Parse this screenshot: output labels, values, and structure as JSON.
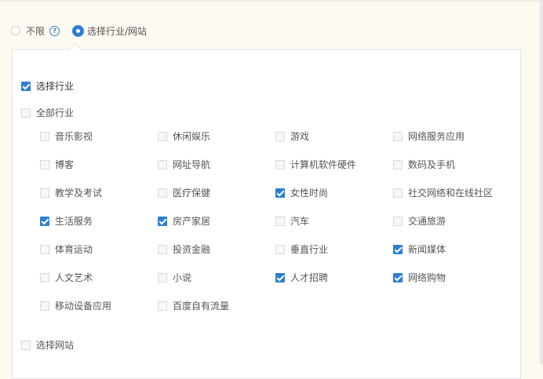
{
  "radio": {
    "unlimited": "不限",
    "industry_site": "选择行业/网站",
    "selected": "industry_site"
  },
  "select_industry": {
    "label": "选择行业",
    "checked": true
  },
  "all_industries": {
    "label": "全部行业",
    "checked": false
  },
  "industries": [
    {
      "label": "音乐影视",
      "checked": false
    },
    {
      "label": "休闲娱乐",
      "checked": false
    },
    {
      "label": "游戏",
      "checked": false
    },
    {
      "label": "网络服务应用",
      "checked": false
    },
    {
      "label": "博客",
      "checked": false
    },
    {
      "label": "网址导航",
      "checked": false
    },
    {
      "label": "计算机软件硬件",
      "checked": false
    },
    {
      "label": "数码及手机",
      "checked": false
    },
    {
      "label": "教学及考试",
      "checked": false
    },
    {
      "label": "医疗保健",
      "checked": false
    },
    {
      "label": "女性时尚",
      "checked": true
    },
    {
      "label": "社交网络和在线社区",
      "checked": false
    },
    {
      "label": "生活服务",
      "checked": true
    },
    {
      "label": "房产家居",
      "checked": true
    },
    {
      "label": "汽车",
      "checked": false
    },
    {
      "label": "交通旅游",
      "checked": false
    },
    {
      "label": "体育运动",
      "checked": false
    },
    {
      "label": "投资金融",
      "checked": false
    },
    {
      "label": "垂直行业",
      "checked": false
    },
    {
      "label": "新闻媒体",
      "checked": true
    },
    {
      "label": "人文艺术",
      "checked": false
    },
    {
      "label": "小说",
      "checked": false
    },
    {
      "label": "人才招聘",
      "checked": true
    },
    {
      "label": "网络购物",
      "checked": true
    },
    {
      "label": "移动设备应用",
      "checked": false
    },
    {
      "label": "百度自有流量",
      "checked": false
    }
  ],
  "select_site": {
    "label": "选择网站",
    "checked": false
  },
  "colors": {
    "accent": "#2d7fd3",
    "background": "#fdfaf1"
  },
  "icons": {
    "help": "question-circle-icon"
  }
}
